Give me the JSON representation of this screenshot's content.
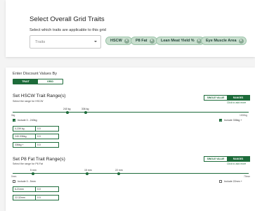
{
  "top": {
    "title": "Select Overall Grid Traits",
    "subtitle": "Select which traits are applicable to this grid",
    "select_placeholder": "Traits",
    "chips": [
      "HSCW",
      "P8 Fat",
      "Lean Meat Yield %",
      "Eye Muscle Area"
    ]
  },
  "discount": {
    "label": "Enter Discount Values By",
    "toggle": {
      "trait": "TRAIT",
      "grid": "GRID"
    }
  },
  "sections": [
    {
      "title": "Set HSCW Trait Range(s)",
      "subtitle": "Select the range for HSCW",
      "seg": {
        "single": "SINGLE VALUE",
        "ranges": "RANGES"
      },
      "click_add": "Click to add more",
      "marks": [
        "240 kg",
        "336 kg"
      ],
      "axis_min": "0kg",
      "axis_max": "1000kg",
      "include_low": "Include 0 - 240kg",
      "include_high": "Include 336kg +",
      "rows": [
        {
          "range": "0-239 kg",
          "value": "0.0"
        },
        {
          "range": "240-336kg",
          "value": "0.0"
        },
        {
          "range": "336kg +",
          "value": "0.0"
        }
      ]
    },
    {
      "title": "Set P8 Fat Trait Range(s)",
      "subtitle": "Select the range for P8 Fat",
      "seg": {
        "single": "SINGLE VALUE",
        "ranges": "RANGES"
      },
      "click_add": "Click to add more",
      "marks": [
        "5 mm",
        "15 mm",
        "22 mm"
      ],
      "axis_min": "0mm",
      "axis_max": "70mm",
      "include_low": "Include 0 - 5mm",
      "include_high": "Include 22mm +",
      "rows": [
        {
          "range": "6-21mm",
          "value": "0.0"
        },
        {
          "range": "22-32mm",
          "value": "0.0"
        }
      ]
    }
  ]
}
